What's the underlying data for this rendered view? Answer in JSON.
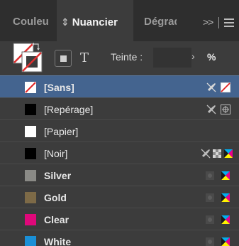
{
  "tabs": [
    {
      "label": "Couleu"
    },
    {
      "label": "Nuancier",
      "active": true
    },
    {
      "label": "Dégrad"
    }
  ],
  "tab_overflow": ">>",
  "controls": {
    "tint_label": "Teinte :",
    "tint_value": "",
    "tint_unit": "%",
    "text_button": "T"
  },
  "swatches": [
    {
      "name": "[Sans]",
      "color": "none",
      "selected": true,
      "icons": [
        "no-edit-icon",
        "none-type-icon"
      ]
    },
    {
      "name": "[Repérage]",
      "color": "#000000",
      "icons": [
        "no-edit-icon",
        "registration-icon"
      ]
    },
    {
      "name": "[Papier]",
      "color": "#ffffff",
      "icons": []
    },
    {
      "name": "[Noir]",
      "color": "#000000",
      "icons": [
        "no-edit-icon",
        "process-icon",
        "cmyk-icon"
      ]
    },
    {
      "name": "Silver",
      "color": "#8a8a86",
      "icons": [
        "process-icon",
        "cmyk-icon"
      ]
    },
    {
      "name": "Gold",
      "color": "#7d6a47",
      "icons": [
        "process-icon",
        "cmyk-icon"
      ]
    },
    {
      "name": "Clear",
      "color": "#e0087a",
      "icons": [
        "process-icon",
        "cmyk-icon"
      ]
    },
    {
      "name": "White",
      "color": "#1a8fd6",
      "icons": [
        "process-icon",
        "cmyk-icon"
      ]
    }
  ],
  "colors": {
    "selection": "#44648f",
    "panel_bg": "#3c3c3c",
    "tab_bg": "#2e2e2e"
  }
}
